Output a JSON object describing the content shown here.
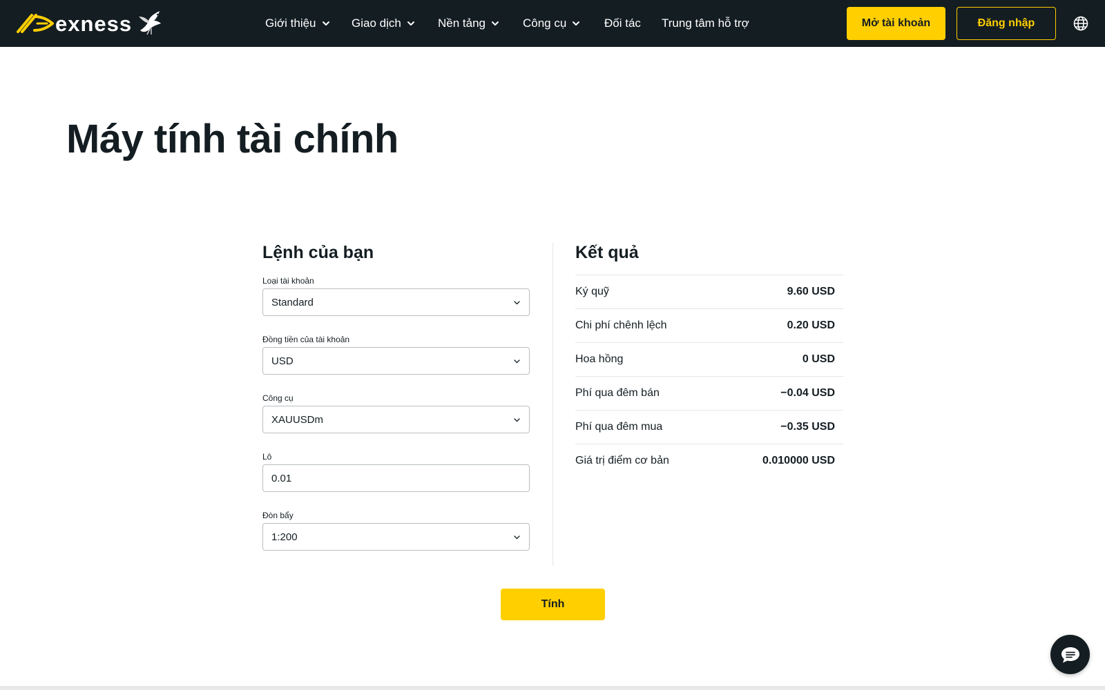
{
  "brand": {
    "name": "exness",
    "accent_color": "#ffcf00",
    "header_bg": "#141d22"
  },
  "nav": {
    "items": [
      {
        "label": "Giới thiệu",
        "has_dropdown": true
      },
      {
        "label": "Giao dịch",
        "has_dropdown": true
      },
      {
        "label": "Nền tảng",
        "has_dropdown": true
      },
      {
        "label": "Công cụ",
        "has_dropdown": true
      },
      {
        "label": "Đối tác",
        "has_dropdown": false
      },
      {
        "label": "Trung tâm hỗ trợ",
        "has_dropdown": false
      }
    ],
    "open_account_label": "Mở tài khoản",
    "login_label": "Đăng nhập",
    "language_icon": "globe-icon"
  },
  "page": {
    "title": "Máy tính tài chính"
  },
  "form": {
    "heading": "Lệnh của bạn",
    "fields": [
      {
        "label": "Loại tài khoản",
        "value": "Standard",
        "type": "select"
      },
      {
        "label": "Đồng tiền của tài khoản",
        "value": "USD",
        "type": "select"
      },
      {
        "label": "Công cụ",
        "value": "XAUUSDm",
        "type": "select"
      },
      {
        "label": "Lô",
        "value": "0.01",
        "type": "input"
      },
      {
        "label": "Đòn bẩy",
        "value": "1:200",
        "type": "select"
      }
    ],
    "calculate_label": "Tính"
  },
  "results": {
    "heading": "Kết quả",
    "rows": [
      {
        "label": "Ký quỹ",
        "value": "9.60 USD"
      },
      {
        "label": "Chi phí chênh lệch",
        "value": "0.20 USD"
      },
      {
        "label": "Hoa hồng",
        "value": "0 USD"
      },
      {
        "label": "Phí qua đêm bán",
        "value": "−0.04 USD"
      },
      {
        "label": "Phí qua đêm mua",
        "value": "−0.35 USD"
      },
      {
        "label": "Giá trị điểm cơ bản",
        "value": "0.010000 USD"
      }
    ]
  },
  "chat": {
    "icon": "chat-icon"
  }
}
